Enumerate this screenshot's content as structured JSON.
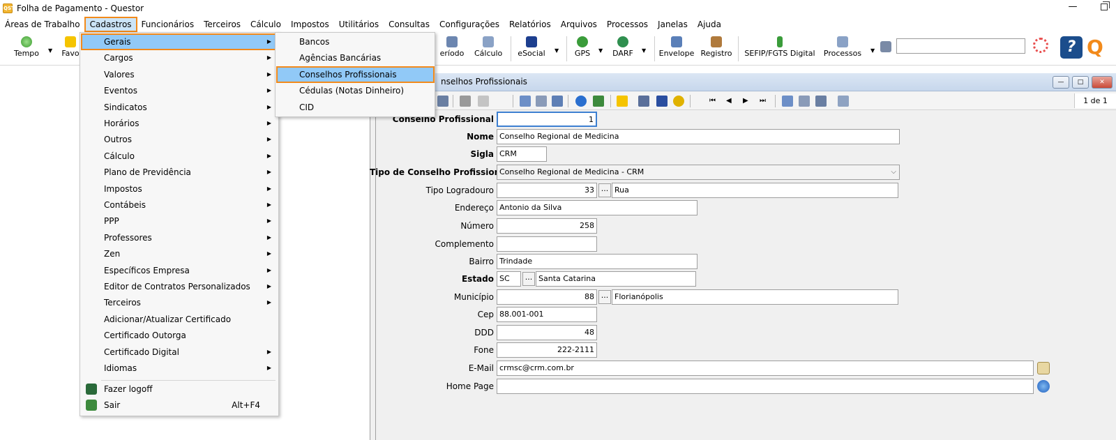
{
  "window": {
    "title": "Folha de Pagamento - Questor",
    "app_icon": "QST"
  },
  "menubar": [
    "Áreas de Trabalho",
    "Cadastros",
    "Funcionários",
    "Terceiros",
    "Cálculo",
    "Impostos",
    "Utilitários",
    "Consultas",
    "Configurações",
    "Relatórios",
    "Arquivos",
    "Processos",
    "Janelas",
    "Ajuda"
  ],
  "toolbar": {
    "tempo": "Tempo",
    "favoritos_partial": "Favo",
    "periodo_partial": "eríodo",
    "calculo": "Cálculo",
    "esocial": "eSocial",
    "gps": "GPS",
    "darf": "DARF",
    "envelope": "Envelope",
    "registro": "Registro",
    "sefip": "SEFIP/FGTS Digital",
    "processos": "Processos",
    "search_value": ""
  },
  "cadastros_menu": [
    {
      "label": "Gerais",
      "sub": true
    },
    {
      "label": "Cargos",
      "sub": true
    },
    {
      "label": "Valores",
      "sub": true
    },
    {
      "label": "Eventos",
      "sub": true
    },
    {
      "label": "Sindicatos",
      "sub": true
    },
    {
      "label": "Horários",
      "sub": true
    },
    {
      "label": "Outros",
      "sub": true
    },
    {
      "label": "Cálculo",
      "sub": true
    },
    {
      "label": "Plano de Previdência",
      "sub": true
    },
    {
      "label": "Impostos",
      "sub": true
    },
    {
      "label": "Contábeis",
      "sub": true
    },
    {
      "label": "PPP",
      "sub": true
    },
    {
      "label": "Professores",
      "sub": true
    },
    {
      "label": "Zen",
      "sub": true
    },
    {
      "label": "Específicos Empresa",
      "sub": true
    },
    {
      "label": "Editor de Contratos Personalizados",
      "sub": true
    },
    {
      "label": "Terceiros",
      "sub": true
    },
    {
      "label": "Adicionar/Atualizar Certificado",
      "sub": false
    },
    {
      "label": "Certificado Outorga",
      "sub": false
    },
    {
      "label": "Certificado Digital",
      "sub": true
    },
    {
      "label": "Idiomas",
      "sub": true
    }
  ],
  "cadastros_bottom": {
    "logoff": "Fazer logoff",
    "sair": "Sair",
    "sair_shortcut": "Alt+F4"
  },
  "gerais_menu": [
    "Bancos",
    "Agências Bancárias",
    "Conselhos Profissionais",
    "Cédulas (Notas Dinheiro)",
    "CID"
  ],
  "child": {
    "title": "nselhos Profissionais",
    "pager": "1 de 1"
  },
  "form": {
    "conselho_label": "Conselho Profissional",
    "conselho_value": "1",
    "nome_label": "Nome",
    "nome_value": "Conselho Regional de Medicina",
    "sigla_label": "Sigla",
    "sigla_value": "CRM",
    "tipo_label": "Tipo de Conselho Profissional",
    "tipo_value": "Conselho Regional de Medicina - CRM",
    "tipolog_label": "Tipo Logradouro",
    "tipolog_code": "33",
    "tipolog_name": "Rua",
    "endereco_label": "Endereço",
    "endereco_value": "Antonio da Silva",
    "numero_label": "Número",
    "numero_value": "258",
    "complemento_label": "Complemento",
    "complemento_value": "",
    "bairro_label": "Bairro",
    "bairro_value": "Trindade",
    "estado_label": "Estado",
    "estado_code": "SC",
    "estado_name": "Santa Catarina",
    "municipio_label": "Município",
    "municipio_code": "88",
    "municipio_name": "Florianópolis",
    "cep_label": "Cep",
    "cep_value": "88.001-001",
    "ddd_label": "DDD",
    "ddd_value": "48",
    "fone_label": "Fone",
    "fone_value": "222-2111",
    "email_label": "E-Mail",
    "email_value": "crmsc@crm.com.br",
    "homepage_label": "Home Page",
    "homepage_value": ""
  },
  "glyphs": {
    "submenu_arrow": "▶",
    "combo_arrow": "⌵",
    "dots": "...",
    "dropdown_arrow": "▼"
  }
}
